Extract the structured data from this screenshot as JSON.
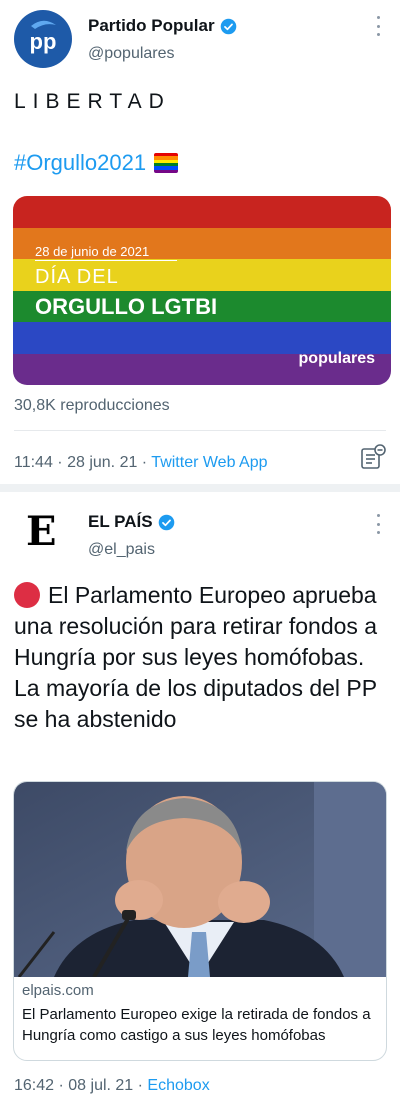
{
  "tweet1": {
    "author_name": "Partido Popular",
    "handle": "@populares",
    "text": "LIBERTAD",
    "hashtag": "#Orgullo2021",
    "image": {
      "date": "28 de junio de 2021",
      "line1": "DÍA DEL",
      "line2": "ORGULLO LGTBI",
      "brand": "populares",
      "stripe_colors": [
        "#c8241f",
        "#e2771c",
        "#e9d21c",
        "#1c8a2e",
        "#2b48c4",
        "#6a2c8c"
      ]
    },
    "views": "30,8K reproducciones",
    "time": "11:44",
    "date": "28 jun. 21",
    "source": "Twitter Web App"
  },
  "tweet2": {
    "author_name": "EL PAÍS",
    "handle": "@el_pais",
    "logo_letter": "E",
    "text": "El Parlamento Europeo aprueba una resolución para retirar fondos a Hungría por sus leyes homófobas. La mayoría de los diputados del PP se ha abstenido",
    "card": {
      "domain": "elpais.com",
      "title": "El Parlamento Europeo exige la retirada de fondos a Hungría como castigo a sus leyes homófobas"
    },
    "time": "16:42",
    "date": "08 jul. 21",
    "source": "Echobox"
  },
  "separator": " · ",
  "colors": {
    "accent": "#1d9bf0",
    "secondary_text": "#536471",
    "pp_blue": "#1e5aa8"
  },
  "icons": [
    "pp-logo-icon",
    "verified-badge-icon",
    "more-options-icon",
    "pride-flag-icon",
    "list-icon",
    "red-circle-icon"
  ]
}
